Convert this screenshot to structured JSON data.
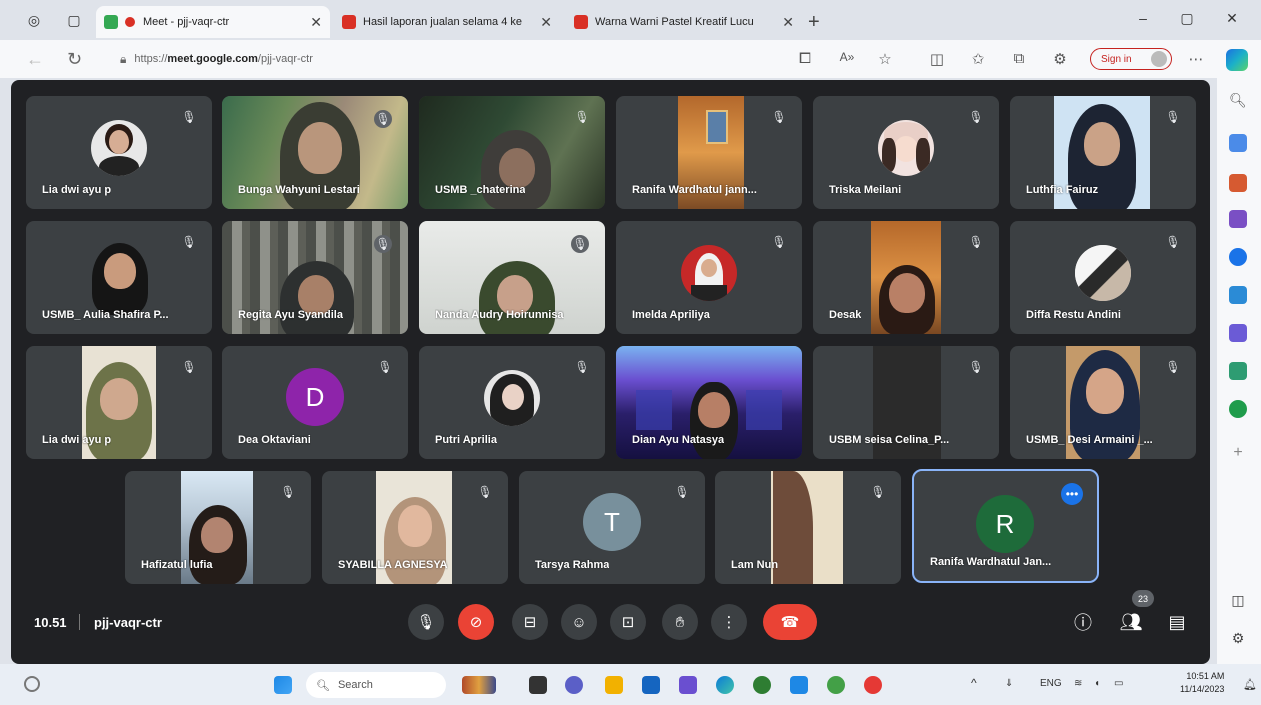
{
  "browser": {
    "tabs": [
      {
        "title": "Meet - pjj-vaqr-ctr",
        "active": true
      },
      {
        "title": "Hasil laporan jualan selama 4 ke",
        "active": false
      },
      {
        "title": "Warna Warni Pastel Kreatif Lucu",
        "active": false
      }
    ],
    "url_prefix": "https://",
    "url_host": "meet.google.com",
    "url_path": "/pjj-vaqr-ctr",
    "sign_in_label": "Sign in"
  },
  "meet": {
    "time": "10.51",
    "meeting_code": "pjj-vaqr-ctr",
    "participant_count": "23",
    "participants": [
      {
        "name": "Lia dwi ayu p",
        "kind": "avatar"
      },
      {
        "name": "Bunga Wahyuni Lestari",
        "kind": "video"
      },
      {
        "name": "USMB _chaterina",
        "kind": "video"
      },
      {
        "name": "Ranifa Wardhatul jann...",
        "kind": "video"
      },
      {
        "name": "Triska Meilani",
        "kind": "avatar"
      },
      {
        "name": "Luthfia Fairuz",
        "kind": "video"
      },
      {
        "name": "USMB_ Aulia Shafira P...",
        "kind": "video"
      },
      {
        "name": "Regita Ayu Syandila",
        "kind": "video"
      },
      {
        "name": "Nanda Audry Hoirunnisa",
        "kind": "video"
      },
      {
        "name": "Imelda Apriliya",
        "kind": "avatar"
      },
      {
        "name": "Desak",
        "kind": "video"
      },
      {
        "name": "Diffa Restu Andini",
        "kind": "avatar"
      },
      {
        "name": "Lia dwi ayu p",
        "kind": "video"
      },
      {
        "name": "Dea Oktaviani",
        "kind": "letter",
        "letter": "D",
        "color": "#8e24aa"
      },
      {
        "name": "Putri Aprilia",
        "kind": "avatar"
      },
      {
        "name": "Dian Ayu Natasya",
        "kind": "video"
      },
      {
        "name": "USBM seisa Celina_P...",
        "kind": "video"
      },
      {
        "name": "USMB_ Desi Armaini _...",
        "kind": "video"
      },
      {
        "name": "Hafizatul lufia",
        "kind": "video"
      },
      {
        "name": "SYABILLA AGNESYA",
        "kind": "video"
      },
      {
        "name": "Tarsya Rahma",
        "kind": "letter",
        "letter": "T",
        "color": "#78909c"
      },
      {
        "name": "Lam Nun",
        "kind": "video"
      },
      {
        "name": "Ranifa Wardhatul Jan...",
        "kind": "letter",
        "letter": "R",
        "color": "#1e6b3a"
      }
    ]
  },
  "taskbar": {
    "search_placeholder": "Search",
    "language": "ENG",
    "time": "10:51 AM",
    "date": "11/14/2023"
  },
  "colors": {
    "stage_bg": "#202124",
    "tile_bg": "#3c4043",
    "end_call": "#ea4335",
    "accent": "#1a73e8"
  }
}
